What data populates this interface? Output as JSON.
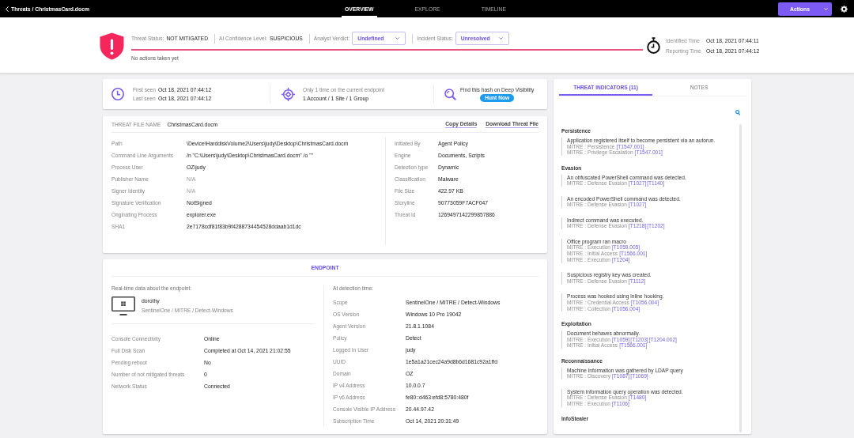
{
  "topbar": {
    "breadcrumb": "Threats / ChristmasCard.docm",
    "tabs": [
      {
        "label": "OVERVIEW",
        "selected": true
      },
      {
        "label": "EXPLORE",
        "selected": false
      },
      {
        "label": "TIMELINE",
        "selected": false
      }
    ],
    "actions_button": "Actions"
  },
  "threat_header": {
    "statuses": [
      {
        "label": "Threat Status:",
        "value": "NOT MITIGATED",
        "kind": "text"
      },
      {
        "label": "AI Confidence Level:",
        "value": "SUSPICIOUS",
        "kind": "text"
      },
      {
        "label": "Analyst Verdict:",
        "value": "Undefined",
        "kind": "dropdown"
      },
      {
        "label": "Incident Status:",
        "value": "Unresolved",
        "kind": "dropdown"
      }
    ],
    "note": "No actions taken yet",
    "times": [
      {
        "label": "Identified Time",
        "value": "Oct 18, 2021 07:44:11"
      },
      {
        "label": "Reporting Time",
        "value": "Oct 18, 2021 07:44:12"
      }
    ]
  },
  "summary": {
    "seen": [
      {
        "label": "First seen",
        "value": "Oct 18, 2021 07:44:12"
      },
      {
        "label": "Last seen",
        "value": "Oct 18, 2021 07:44:12"
      }
    ],
    "occurrence": {
      "text": "Only 1 time on the current endpoint",
      "scope": "1 Account / 1 Site / 1 Group"
    },
    "hunt": {
      "text": "Find this hash on Deep Visibility",
      "button": "Hunt Now"
    }
  },
  "threat_file": {
    "label": "THREAT FILE NAME",
    "name": "ChristmasCard.docm",
    "links": [
      "Copy Details",
      "Download Threat File"
    ],
    "left_fields": [
      {
        "label": "Path",
        "value": "\\Device\\HarddiskVolume2\\Users\\judy\\Desktop\\ChristmasCard.docm",
        "muted": false
      },
      {
        "label": "Command Line Arguments",
        "value": "/n \"C:\\Users\\judy\\Desktop\\ChristmasCard.docm\" /o \"\"",
        "muted": false
      },
      {
        "label": "Process User",
        "value": "OZ\\judy",
        "muted": false
      },
      {
        "label": "Publisher Name",
        "value": "N/A",
        "muted": true
      },
      {
        "label": "Signer Identity",
        "value": "N/A",
        "muted": true
      },
      {
        "label": "Signature Verification",
        "value": "NotSigned",
        "muted": false
      },
      {
        "label": "Originating Process",
        "value": "explorer.exe",
        "muted": false
      },
      {
        "label": "SHA1",
        "value": "2e7178cdf81f83b9f4288734454528ddaab1d1dc",
        "muted": false
      }
    ],
    "right_fields": [
      {
        "label": "Initiated By",
        "value": "Agent Policy"
      },
      {
        "label": "Engine",
        "value": "Documents, Scripts"
      },
      {
        "label": "Detection type",
        "value": "Dynamic"
      },
      {
        "label": "Classification",
        "value": "Malware"
      },
      {
        "label": "File Size",
        "value": "422.97 KB"
      },
      {
        "label": "Storyline",
        "value": "90773059F7ACF047"
      },
      {
        "label": "Threat Id",
        "value": "1269497142299857886"
      }
    ]
  },
  "endpoint": {
    "title": "ENDPOINT",
    "realtime_label": "Real-time data about the endpoint:",
    "device": {
      "name": "dorothy",
      "scope": "SentinelOne / MITRE / Detect-Windows"
    },
    "realtime_fields": [
      {
        "label": "Console Connectivity",
        "value": "Online"
      },
      {
        "label": "Full Disk Scan",
        "value": "Completed at Oct 14, 2021 21:02:55"
      },
      {
        "label": "Pending reboot",
        "value": "No"
      },
      {
        "label": "Number of not mitigated threats",
        "value": "0"
      },
      {
        "label": "Network Status",
        "value": "Connected"
      }
    ],
    "detection_label": "At detection time:",
    "detection_fields": [
      {
        "label": "Scope",
        "value": "SentinelOne / MITRE / Detect-Windows"
      },
      {
        "label": "OS Version",
        "value": "Windows 10 Pro 19042"
      },
      {
        "label": "Agent Version",
        "value": "21.8.1.1084"
      },
      {
        "label": "Policy",
        "value": "Detect"
      },
      {
        "label": "Logged In User",
        "value": "judy"
      },
      {
        "label": "UUID",
        "value": "1e5a1a21cec24a9d8b6d1681c92a1ffd"
      },
      {
        "label": "Domain",
        "value": "OZ"
      },
      {
        "label": "IP v4 Address",
        "value": "10.0.0.7"
      },
      {
        "label": "IP v6 Address",
        "value": "fe80::d463:efd8:5780:480f"
      },
      {
        "label": "Console Visible IP Address",
        "value": "20.44.97.42"
      },
      {
        "label": "Subscription Time",
        "value": "Oct 14, 2021 20:31:49"
      }
    ]
  },
  "indicators_panel": {
    "tabs": [
      {
        "label": "THREAT INDICATORS (11)",
        "selected": true
      },
      {
        "label": "NOTES",
        "selected": false
      }
    ],
    "groups": [
      {
        "name": "Persistence",
        "items": [
          {
            "title": "Application registered itself to become persistent via an autorun.",
            "mitre": [
              {
                "label": "MITRE : Persistence",
                "techniques": [
                  "[T1547.001]"
                ]
              },
              {
                "label": "MITRE : Privilege Escalation",
                "techniques": [
                  "[T1547.001]"
                ]
              }
            ]
          }
        ]
      },
      {
        "name": "Evasion",
        "items": [
          {
            "title": "An obfuscated PowerShell command was detected.",
            "mitre": [
              {
                "label": "MITRE : Defense Evasion",
                "techniques": [
                  "[T1027]",
                  "[T1140]"
                ]
              }
            ]
          },
          {
            "title": "An encoded PowerShell command was detected.",
            "mitre": [
              {
                "label": "MITRE : Defense Evasion",
                "techniques": [
                  "[T1027]"
                ]
              }
            ]
          },
          {
            "title": "Indirect command was executed.",
            "mitre": [
              {
                "label": "MITRE : Defense Evasion",
                "techniques": [
                  "[T1218]",
                  "[T1202]"
                ]
              }
            ]
          },
          {
            "title": "Office program ran macro",
            "mitre": [
              {
                "label": "MITRE : Execution",
                "techniques": [
                  "[T1059.005]"
                ]
              },
              {
                "label": "MITRE : Initial Access",
                "techniques": [
                  "[T1566.001]"
                ]
              },
              {
                "label": "MITRE : Execution",
                "techniques": [
                  "[T1204]"
                ]
              }
            ]
          },
          {
            "title": "Suspicious registry key was created.",
            "mitre": [
              {
                "label": "MITRE : Defense Evasion",
                "techniques": [
                  "[T1112]"
                ]
              }
            ]
          },
          {
            "title": "Process was hooked using inline hooking.",
            "mitre": [
              {
                "label": "MITRE : Credential Access",
                "techniques": [
                  "[T1056.004]"
                ]
              },
              {
                "label": "MITRE : Collection",
                "techniques": [
                  "[T1056.004]"
                ]
              }
            ]
          }
        ]
      },
      {
        "name": "Exploitation",
        "items": [
          {
            "title": "Document behaves abnormally.",
            "mitre": [
              {
                "label": "MITRE : Execution",
                "techniques": [
                  "[T1059]",
                  "[T1203]",
                  "[T1204.002]"
                ]
              },
              {
                "label": "MITRE : Initial Access",
                "techniques": [
                  "[T1566.001]"
                ]
              }
            ]
          }
        ]
      },
      {
        "name": "Reconnaissance",
        "items": [
          {
            "title": "Machine information was gathered by LDAP query",
            "mitre": [
              {
                "label": "MITRE : Discovery",
                "techniques": [
                  "[T1087]",
                  "[T1069]"
                ]
              }
            ]
          },
          {
            "title": "System information query operation was detected.",
            "mitre": [
              {
                "label": "MITRE : Defense Evasion",
                "techniques": [
                  "[T1480]"
                ]
              },
              {
                "label": "MITRE : Execution",
                "techniques": [
                  "[T1106]"
                ]
              }
            ]
          }
        ]
      },
      {
        "name": "InfoStealer"
      }
    ]
  }
}
